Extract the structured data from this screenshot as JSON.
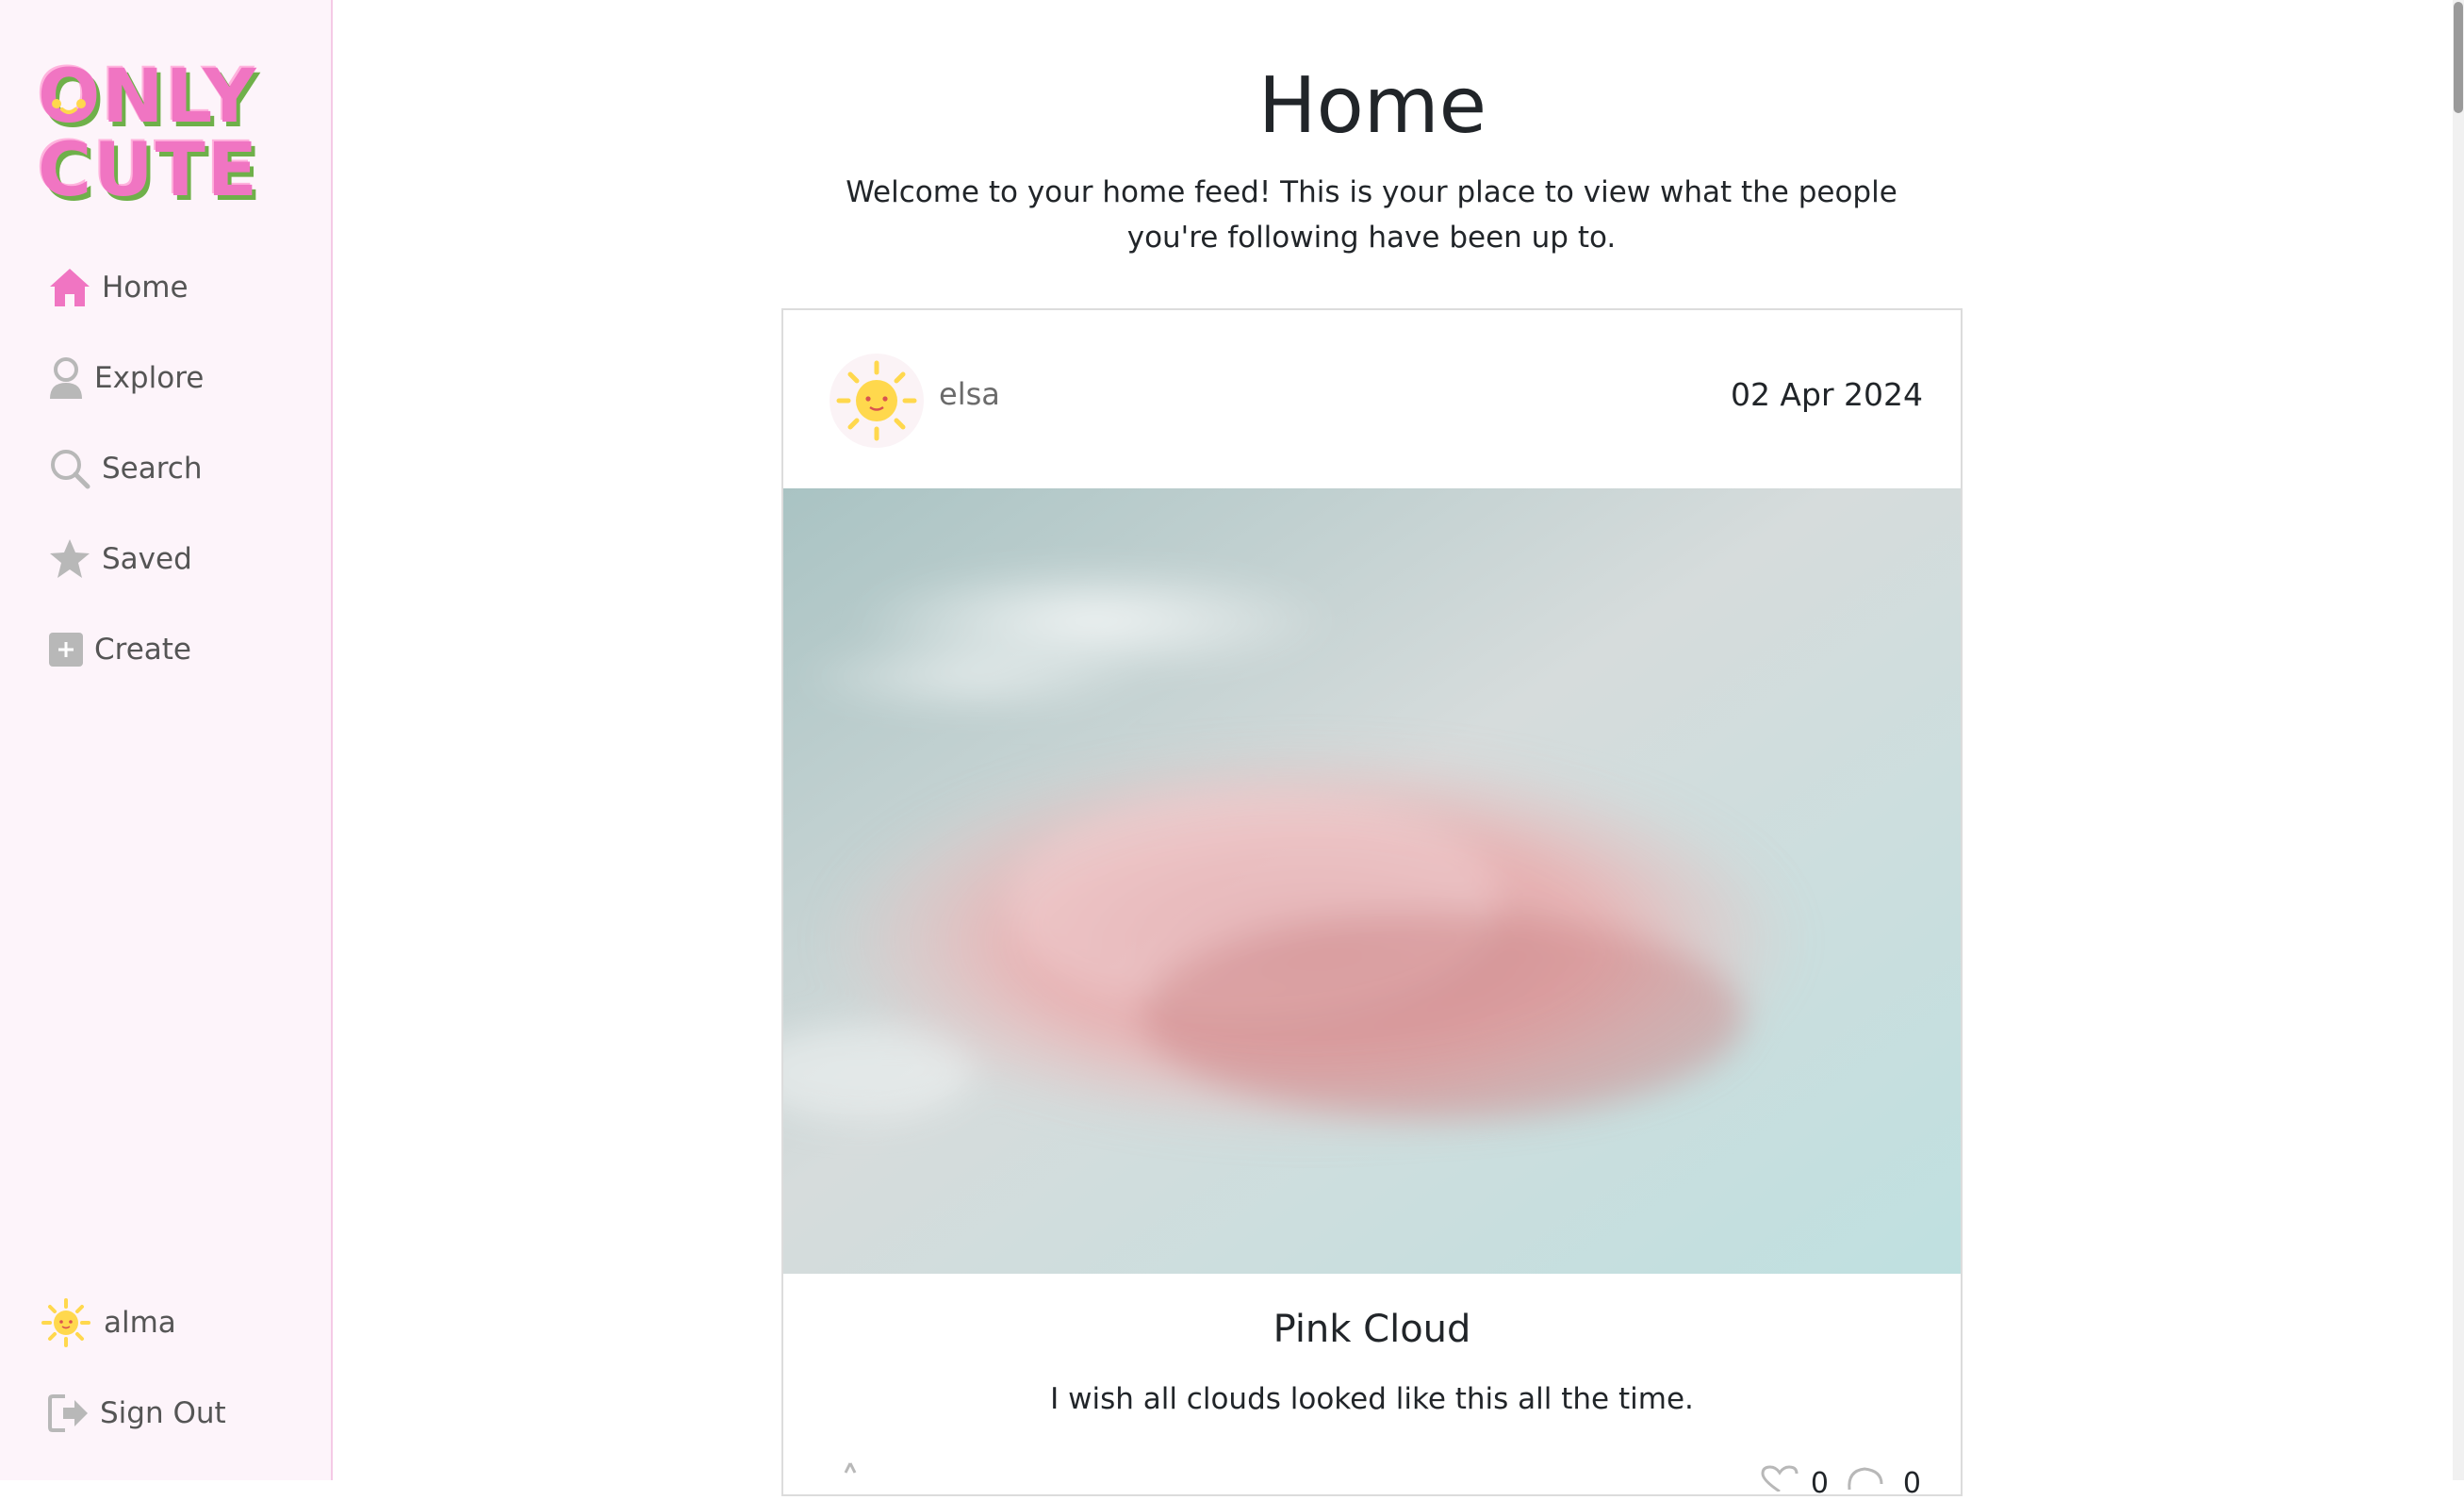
{
  "sidebar": {
    "logo": {
      "line1": "ONLY",
      "line2": "CUTE"
    },
    "nav": [
      {
        "label": "Home",
        "icon": "home-icon",
        "active": true
      },
      {
        "label": "Explore",
        "icon": "person-icon"
      },
      {
        "label": "Search",
        "icon": "search-icon"
      },
      {
        "label": "Saved",
        "icon": "star-icon"
      },
      {
        "label": "Create",
        "icon": "plus-square-icon"
      }
    ],
    "user": {
      "name": "alma",
      "icon": "sun-avatar-icon"
    },
    "signout": {
      "label": "Sign Out",
      "icon": "sign-out-icon"
    }
  },
  "main": {
    "title": "Home",
    "subtitle": "Welcome to your home feed! This is your place to view what the people you're following have been up to."
  },
  "post": {
    "user": "elsa",
    "date": "02 Apr 2024",
    "title": "Pink Cloud",
    "description": "I wish all clouds looked like this all the time.",
    "likes": "0",
    "comments": "0"
  },
  "colors": {
    "accent": "#f075c2",
    "sidebar_bg": "#fdf4fa",
    "icon_gray": "#b8b8b8"
  }
}
